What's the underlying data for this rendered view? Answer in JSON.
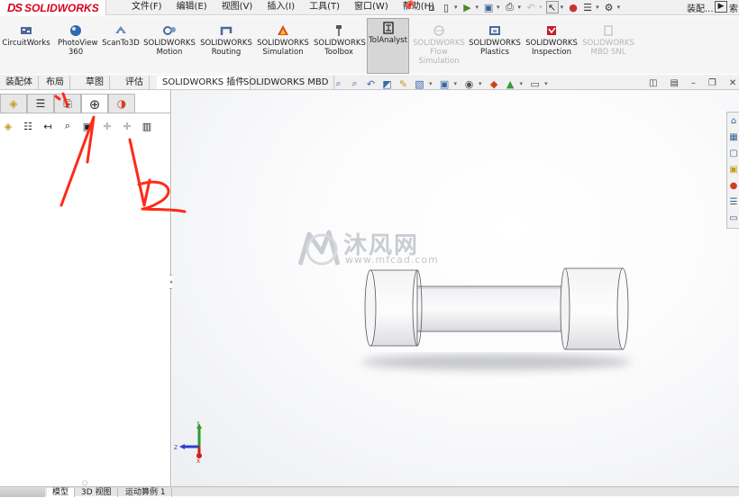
{
  "app": {
    "name": "SOLIDWORKS",
    "logo_ds": "DS"
  },
  "menu": [
    "文件(F)",
    "编辑(E)",
    "视图(V)",
    "插入(I)",
    "工具(T)",
    "窗口(W)",
    "帮助(H)"
  ],
  "quick_access": {
    "last_label": "装配..."
  },
  "command_buttons": [
    {
      "label": "CircuitWorks",
      "icon": "circuitworks-icon"
    },
    {
      "label": "PhotoView 360",
      "icon": "photoview-icon"
    },
    {
      "label": "ScanTo3D",
      "icon": "scanto3d-icon"
    },
    {
      "label": "SOLIDWORKS Motion",
      "icon": "motion-icon"
    },
    {
      "label": "SOLIDWORKS Routing",
      "icon": "routing-icon"
    },
    {
      "label": "SOLIDWORKS Simulation",
      "icon": "simulation-icon"
    },
    {
      "label": "SOLIDWORKS Toolbox",
      "icon": "toolbox-icon"
    },
    {
      "label": "TolAnalyst",
      "icon": "tolanalyst-icon",
      "active": true
    },
    {
      "label": "SOLIDWORKS Flow Simulation",
      "icon": "flow-simulation-icon",
      "disabled": true
    },
    {
      "label": "SOLIDWORKS Plastics",
      "icon": "plastics-icon"
    },
    {
      "label": "SOLIDWORKS Inspection",
      "icon": "inspection-icon"
    },
    {
      "label": "SOLIDWORKS MBD SNL",
      "icon": "mbd-snl-icon",
      "disabled": true
    }
  ],
  "cmd_tabs": [
    {
      "label": "装配体"
    },
    {
      "label": "布局"
    },
    {
      "label": "草图"
    },
    {
      "label": "评估"
    },
    {
      "label": "SOLIDWORKS 插件",
      "selected": true
    },
    {
      "label": "SOLIDWORKS MBD"
    }
  ],
  "fm_tabs": [
    {
      "icon": "feature-tree-icon"
    },
    {
      "icon": "property-manager-icon"
    },
    {
      "icon": "configuration-manager-icon"
    },
    {
      "icon": "dimxpert-manager-icon",
      "selected": true
    },
    {
      "icon": "display-manager-icon"
    }
  ],
  "watermark": {
    "name": "沐风网",
    "url": "www.mfcad.com"
  },
  "triad": {
    "y": "Y",
    "z": "Z",
    "x": "X"
  },
  "annotations": {
    "label1": "1",
    "label2": "2",
    "color": "#ff2a1a"
  },
  "bottom_tabs": [
    {
      "label": "模型",
      "selected": true
    },
    {
      "label": "3D 视图"
    },
    {
      "label": "运动算例 1"
    }
  ],
  "colors": {
    "accent": "#d8001c",
    "active_cmd": "#d6d6d6"
  }
}
